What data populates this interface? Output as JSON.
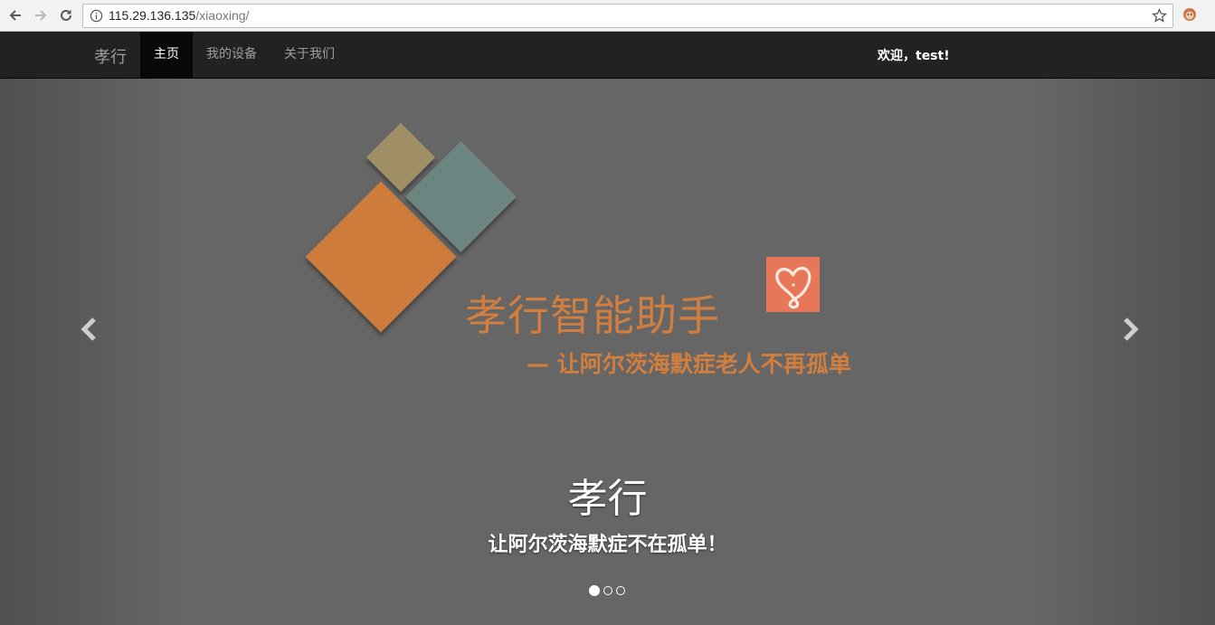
{
  "browser": {
    "url_host": "115.29.136.135",
    "url_path": "/xiaoxing/"
  },
  "navbar": {
    "brand": "孝行",
    "items": [
      {
        "label": "主页",
        "active": true
      },
      {
        "label": "我的设备",
        "active": false
      },
      {
        "label": "关于我们",
        "active": false
      }
    ],
    "welcome": "欢迎，test!"
  },
  "carousel": {
    "banner_title": "孝行智能助手",
    "banner_subtitle": "— 让阿尔茨海默症老人不再孤单",
    "caption_title": "孝行",
    "caption_subtitle": "让阿尔茨海默症不在孤单！",
    "slide_count": 3,
    "active_slide": 1,
    "colors": {
      "accent_orange": "#d17e3f",
      "tile_orange": "#cd7c3c",
      "tile_teal": "#6c8580",
      "tile_khaki": "#a08f66",
      "icon_bg": "#e8775a"
    },
    "icons": [
      "chevron-left-icon",
      "chevron-right-icon",
      "heart-app-icon"
    ]
  }
}
